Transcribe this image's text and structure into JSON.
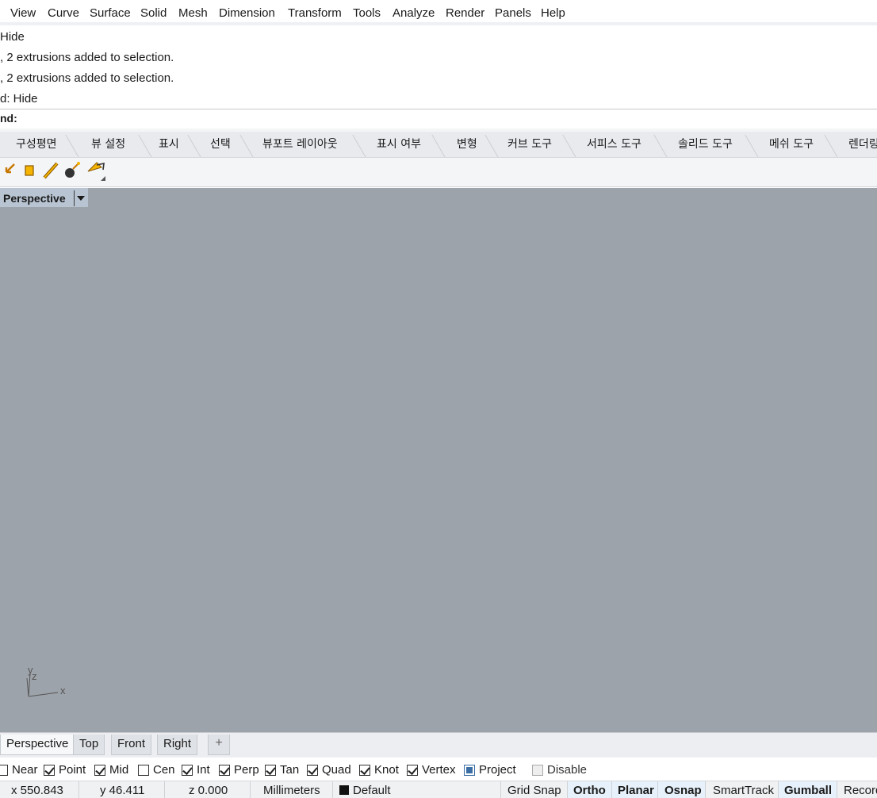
{
  "menubar": {
    "items": [
      "View",
      "Curve",
      "Surface",
      "Solid",
      "Mesh",
      "Dimension",
      "Transform",
      "Tools",
      "Analyze",
      "Render",
      "Panels",
      "Help"
    ]
  },
  "history": {
    "lines": [
      " Hide",
      ", 2 extrusions added to selection.",
      ", 2 extrusions added to selection.",
      "d: Hide"
    ],
    "prompt": "nd:"
  },
  "toolbar_tabs": [
    "구성평면",
    "뷰 설정",
    "표시",
    "선택",
    "뷰포트 레이아웃",
    "표시 여부",
    "변형",
    "커브 도구",
    "서피스 도구",
    "솔리드 도구",
    "메쉬 도구",
    "렌더링"
  ],
  "icons": [
    "pan-arrow-icon",
    "box-icon",
    "pencil-icon",
    "bomb-icon",
    "lamp-icon"
  ],
  "viewport": {
    "title": "Perspective",
    "axes": {
      "y": "y",
      "z": "z",
      "x": "x"
    },
    "background": "#9da3aa"
  },
  "viewport_tabs": [
    "Perspective",
    "Top",
    "Front",
    "Right"
  ],
  "add_tab_label": "+",
  "osnap": [
    {
      "label": "Near",
      "checked": false
    },
    {
      "label": "Point",
      "checked": true
    },
    {
      "label": "Mid",
      "checked": true
    },
    {
      "label": "Cen",
      "checked": false
    },
    {
      "label": "Int",
      "checked": true
    },
    {
      "label": "Perp",
      "checked": true
    },
    {
      "label": "Tan",
      "checked": true
    },
    {
      "label": "Quad",
      "checked": true
    },
    {
      "label": "Knot",
      "checked": true
    },
    {
      "label": "Vertex",
      "checked": true
    },
    {
      "label": "Project",
      "checked": "partial"
    },
    {
      "label": "Disable",
      "checked": false
    }
  ],
  "status": {
    "x": "x 550.843",
    "y": "y 46.411",
    "z": "z 0.000",
    "units": "Millimeters",
    "layer": "Default",
    "layer_color": "#111111",
    "toggles": [
      "Grid Snap",
      "Ortho",
      "Planar",
      "Osnap",
      "SmartTrack",
      "Gumball",
      "Record"
    ]
  }
}
